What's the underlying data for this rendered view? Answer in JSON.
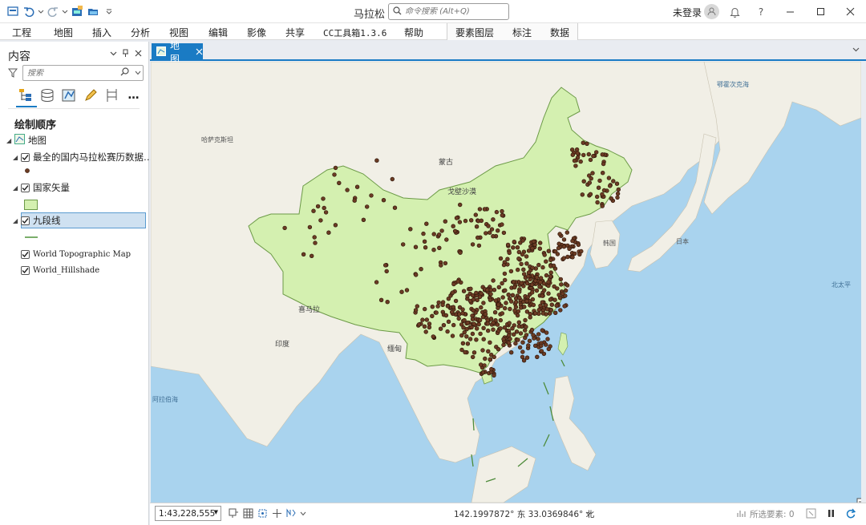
{
  "window": {
    "title": "马拉松",
    "command_search_placeholder": "命令搜索 (Alt+Q)",
    "sign_in": "未登录"
  },
  "ribbon": {
    "tabs": [
      "工程",
      "地图",
      "插入",
      "分析",
      "视图",
      "编辑",
      "影像",
      "共享",
      "CC工具箱1.3.6",
      "帮助"
    ],
    "context_tabs": [
      "要素图层",
      "标注",
      "数据"
    ]
  },
  "contents": {
    "title": "内容",
    "search_placeholder": "搜索",
    "section": "绘制顺序",
    "map_name": "地图",
    "layers": [
      {
        "name": "最全的国内马拉松赛历数据…",
        "checked": true
      },
      {
        "name": "国家矢量",
        "checked": true
      },
      {
        "name": "九段线",
        "checked": true,
        "selected": true
      },
      {
        "name": "World Topographic Map",
        "checked": true
      },
      {
        "name": "World_Hillshade",
        "checked": true
      }
    ]
  },
  "map_tab": {
    "label": "地图"
  },
  "map": {
    "labels": {
      "kazakhstan": "哈萨克斯坦",
      "mongolia": "蒙古",
      "gobi": "戈壁沙漠",
      "himalaya": "喜马拉",
      "india": "印度",
      "myanmar": "缅甸",
      "korea": "韩国",
      "japan": "日本",
      "sea_of_okhotsk": "鄂霍次克海",
      "pacific": "北太平",
      "arabian_sea": "阿拉伯海"
    },
    "colors": {
      "ocean": "#a9d3ee",
      "land": "#f1efe6",
      "china_fill": "#d4f0b0",
      "points": "#6b3b23",
      "accent": "#1a7bc4"
    }
  },
  "statusbar": {
    "scale": "1:43,228,555",
    "coordinates": "142.1997872° 东  33.0369846° 北",
    "selected_features": "所选要素: 0"
  }
}
